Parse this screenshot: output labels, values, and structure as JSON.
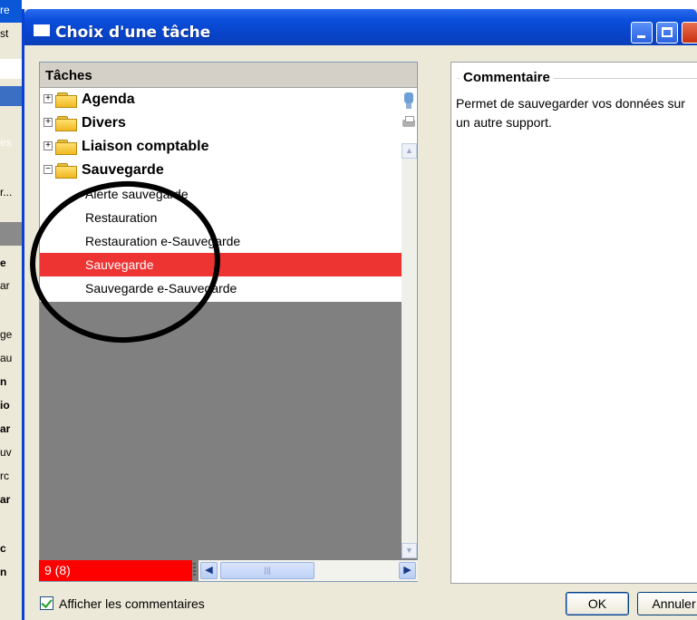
{
  "background_app": {
    "fragments": [
      "re",
      "st",
      "es",
      "r...",
      "e",
      "ar",
      "ge",
      "au",
      "n",
      "io",
      "ar",
      "uv",
      "rc",
      "ar",
      "c",
      "n"
    ]
  },
  "window": {
    "title": "Choix d'une tâche"
  },
  "tree": {
    "header": "Tâches",
    "categories": [
      {
        "label": "Agenda",
        "expander": "+"
      },
      {
        "label": "Divers",
        "expander": "+"
      },
      {
        "label": "Liaison comptable",
        "expander": "+"
      },
      {
        "label": "Sauvegarde",
        "expander": "−"
      }
    ],
    "items": [
      {
        "label": "Alerte sauvegarde",
        "selected": false
      },
      {
        "label": "Restauration",
        "selected": false
      },
      {
        "label": "Restauration e-Sauvegarde",
        "selected": false
      },
      {
        "label": "Sauvegarde",
        "selected": true
      },
      {
        "label": "Sauvegarde e-Sauvegarde",
        "selected": false
      }
    ]
  },
  "status": {
    "count": "9 (8)"
  },
  "comment": {
    "title": "Commentaire",
    "text": "Permet de sauvegarder vos données sur un autre support."
  },
  "footer": {
    "show_comments_label": "Afficher les commentaires",
    "show_comments_checked": true,
    "ok_label": "OK",
    "cancel_label": "Annuler"
  },
  "colors": {
    "selection": "#ee3333",
    "status_bg": "#ff0000",
    "titlebar": "#0a4fdb"
  },
  "icons": {
    "title": "window-icon",
    "folder": "folder-icon"
  }
}
